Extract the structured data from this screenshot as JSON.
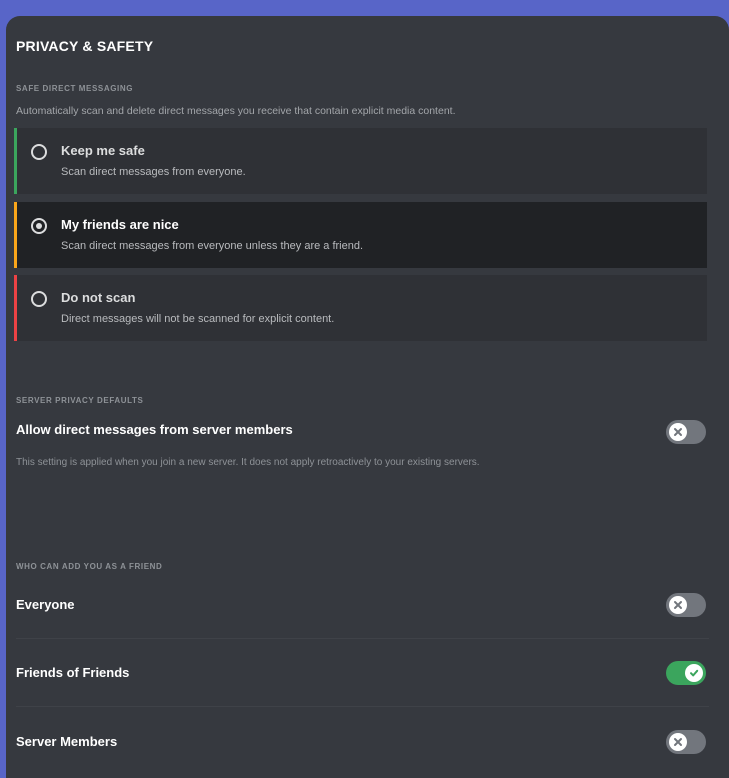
{
  "page": {
    "title": "PRIVACY & SAFETY"
  },
  "safe_dm": {
    "label": "SAFE DIRECT MESSAGING",
    "description": "Automatically scan and delete direct messages you receive that contain explicit media content.",
    "options": [
      {
        "title": "Keep me safe",
        "subtitle": "Scan direct messages from everyone.",
        "selected": false,
        "accent": "#3ba55d"
      },
      {
        "title": "My friends are nice",
        "subtitle": "Scan direct messages from everyone unless they are a friend.",
        "selected": true,
        "accent": "#faa61a"
      },
      {
        "title": "Do not scan",
        "subtitle": "Direct messages will not be scanned for explicit content.",
        "selected": false,
        "accent": "#ed4245"
      }
    ]
  },
  "server_privacy": {
    "label": "SERVER PRIVACY DEFAULTS",
    "title": "Allow direct messages from server members",
    "description": "This setting is applied when you join a new server. It does not apply retroactively to your existing servers.",
    "enabled": false
  },
  "friend_requests": {
    "label": "WHO CAN ADD YOU AS A FRIEND",
    "items": [
      {
        "title": "Everyone",
        "enabled": false
      },
      {
        "title": "Friends of Friends",
        "enabled": true
      },
      {
        "title": "Server Members",
        "enabled": false
      }
    ]
  },
  "colors": {
    "accent_background": "#5865c8",
    "panel": "#36393f",
    "toggle_on": "#3ba55d",
    "toggle_off": "#72767d"
  }
}
